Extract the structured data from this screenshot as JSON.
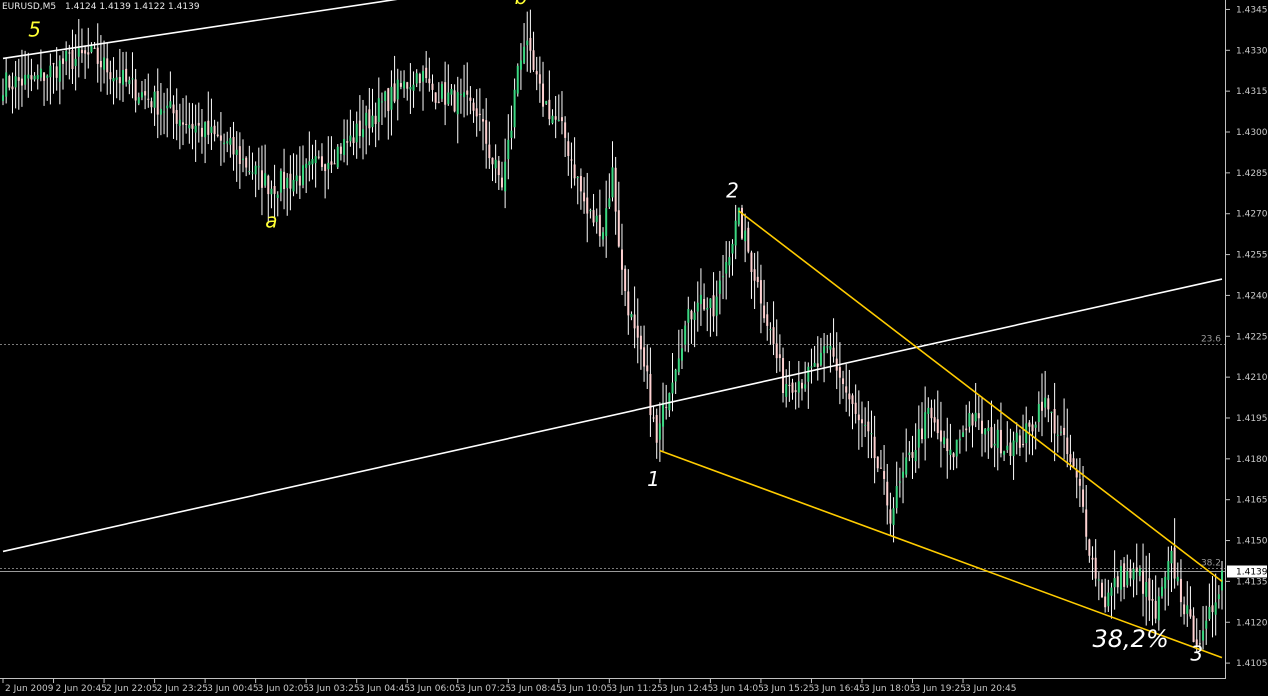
{
  "header": {
    "symbol": "EURUSD,M5",
    "ohlc": "1.4124 1.4139 1.4122 1.4139"
  },
  "colors": {
    "background": "#000000",
    "bull_body": "#3cd782",
    "bear_body": "#ffd2d2",
    "wick": "#ffffff",
    "axis": "#c0c0c0",
    "trendline": "#ffffff",
    "channel": "#ffcc00",
    "wave_label_yellow": "#ffff33",
    "wave_label_white": "#ffffff",
    "fib_line": "#7a7a7a",
    "bid_line": "#9a9a9a"
  },
  "chart_data": {
    "type": "candlestick",
    "title": "",
    "ylim": [
      1.4101,
      1.4347
    ],
    "y_ticks": [
      "1.4345",
      "1.4330",
      "1.4315",
      "1.4300",
      "1.4285",
      "1.4270",
      "1.4255",
      "1.4240",
      "1.4225",
      "1.4210",
      "1.4195",
      "1.4180",
      "1.4165",
      "1.4150",
      "1.4135",
      "1.4120",
      "1.4105"
    ],
    "x_ticks": [
      "2 Jun 2009",
      "2 Jun 20:45",
      "2 Jun 22:05",
      "2 Jun 23:25",
      "3 Jun 00:45",
      "3 Jun 02:05",
      "3 Jun 03:25",
      "3 Jun 04:45",
      "3 Jun 06:05",
      "3 Jun 07:25",
      "3 Jun 08:45",
      "3 Jun 10:05",
      "3 Jun 11:25",
      "3 Jun 12:45",
      "3 Jun 14:05",
      "3 Jun 15:25",
      "3 Jun 16:45",
      "3 Jun 18:05",
      "3 Jun 19:25",
      "3 Jun 20:45"
    ],
    "bars_per_tick": 16,
    "close_path": [
      [
        0,
        1.4318
      ],
      [
        10,
        1.4319
      ],
      [
        20,
        1.4326
      ],
      [
        28,
        1.4328
      ],
      [
        40,
        1.4317
      ],
      [
        55,
        1.4306
      ],
      [
        70,
        1.4296
      ],
      [
        80,
        1.4285
      ],
      [
        85,
        1.428
      ],
      [
        95,
        1.4284
      ],
      [
        110,
        1.4297
      ],
      [
        120,
        1.431
      ],
      [
        132,
        1.4322
      ],
      [
        135,
        1.4316
      ],
      [
        150,
        1.4308
      ],
      [
        155,
        1.4289
      ],
      [
        158,
        1.4281
      ],
      [
        161,
        1.4302
      ],
      [
        163,
        1.4325
      ],
      [
        165,
        1.4333
      ],
      [
        170,
        1.4314
      ],
      [
        178,
        1.4298
      ],
      [
        185,
        1.427
      ],
      [
        190,
        1.4265
      ],
      [
        193,
        1.4285
      ],
      [
        196,
        1.4248
      ],
      [
        200,
        1.4225
      ],
      [
        204,
        1.4208
      ],
      [
        207,
        1.4185
      ],
      [
        210,
        1.4203
      ],
      [
        215,
        1.4225
      ],
      [
        220,
        1.424
      ],
      [
        225,
        1.4233
      ],
      [
        230,
        1.4258
      ],
      [
        233,
        1.4268
      ],
      [
        240,
        1.424
      ],
      [
        247,
        1.4208
      ],
      [
        255,
        1.421
      ],
      [
        262,
        1.422
      ],
      [
        270,
        1.4195
      ],
      [
        275,
        1.4185
      ],
      [
        281,
        1.416
      ],
      [
        288,
        1.4183
      ],
      [
        293,
        1.4196
      ],
      [
        300,
        1.418
      ],
      [
        306,
        1.4196
      ],
      [
        312,
        1.4188
      ],
      [
        320,
        1.4185
      ],
      [
        325,
        1.419
      ],
      [
        329,
        1.4202
      ],
      [
        335,
        1.4188
      ],
      [
        341,
        1.4168
      ],
      [
        345,
        1.4142
      ],
      [
        349,
        1.4128
      ],
      [
        354,
        1.4137
      ],
      [
        360,
        1.4137
      ],
      [
        365,
        1.4122
      ],
      [
        370,
        1.4143
      ],
      [
        376,
        1.4118
      ],
      [
        380,
        1.4113
      ],
      [
        384,
        1.413
      ],
      [
        386,
        1.4139
      ]
    ],
    "highlight_bars": [
      {
        "bar": 28,
        "high": 1.4333
      },
      {
        "bar": 85,
        "low": 1.4272
      },
      {
        "bar": 165,
        "high": 1.434
      },
      {
        "bar": 207,
        "low": 1.418
      },
      {
        "bar": 233,
        "high": 1.427
      },
      {
        "bar": 281,
        "low": 1.4152
      },
      {
        "bar": 380,
        "low": 1.411
      }
    ],
    "wave_labels": [
      {
        "text": "5",
        "bar": 10,
        "price": 1.4335,
        "color": "yellow"
      },
      {
        "text": "a",
        "bar": 85,
        "price": 1.4265,
        "color": "yellow"
      },
      {
        "text": "b",
        "bar": 164,
        "price": 1.4347,
        "color": "yellow"
      },
      {
        "text": "1",
        "bar": 206,
        "price": 1.417,
        "color": "white"
      },
      {
        "text": "2",
        "bar": 231,
        "price": 1.4276,
        "color": "white"
      },
      {
        "text": "3",
        "bar": 378,
        "price": 1.4106,
        "color": "white"
      }
    ],
    "trendlines": [
      {
        "name": "upper-trendline",
        "color": "white",
        "p1": {
          "bar": 0,
          "price": 1.4327
        },
        "p2": {
          "bar": 132,
          "price": 1.435
        }
      },
      {
        "name": "lower-trendline",
        "color": "white",
        "p1": {
          "bar": 0,
          "price": 1.4146
        },
        "p2": {
          "bar": 386,
          "price": 1.4246
        }
      },
      {
        "name": "channel-top",
        "color": "channel",
        "p1": {
          "bar": 233,
          "price": 1.4271
        },
        "p2": {
          "bar": 386,
          "price": 1.4135
        }
      },
      {
        "name": "channel-bottom",
        "color": "channel",
        "p1": {
          "bar": 208,
          "price": 1.4183
        },
        "p2": {
          "bar": 386,
          "price": 1.4107
        }
      }
    ],
    "levels": [
      {
        "name": "fib-23-6",
        "label": "23.6",
        "price": 1.4222
      },
      {
        "name": "fib-38-2",
        "label": "38.2",
        "price": 1.414
      }
    ],
    "bid": {
      "label": "1.4139",
      "price": 1.4139
    },
    "annotation": {
      "text": "38,2%",
      "bar": 345,
      "price": 1.4111
    }
  }
}
